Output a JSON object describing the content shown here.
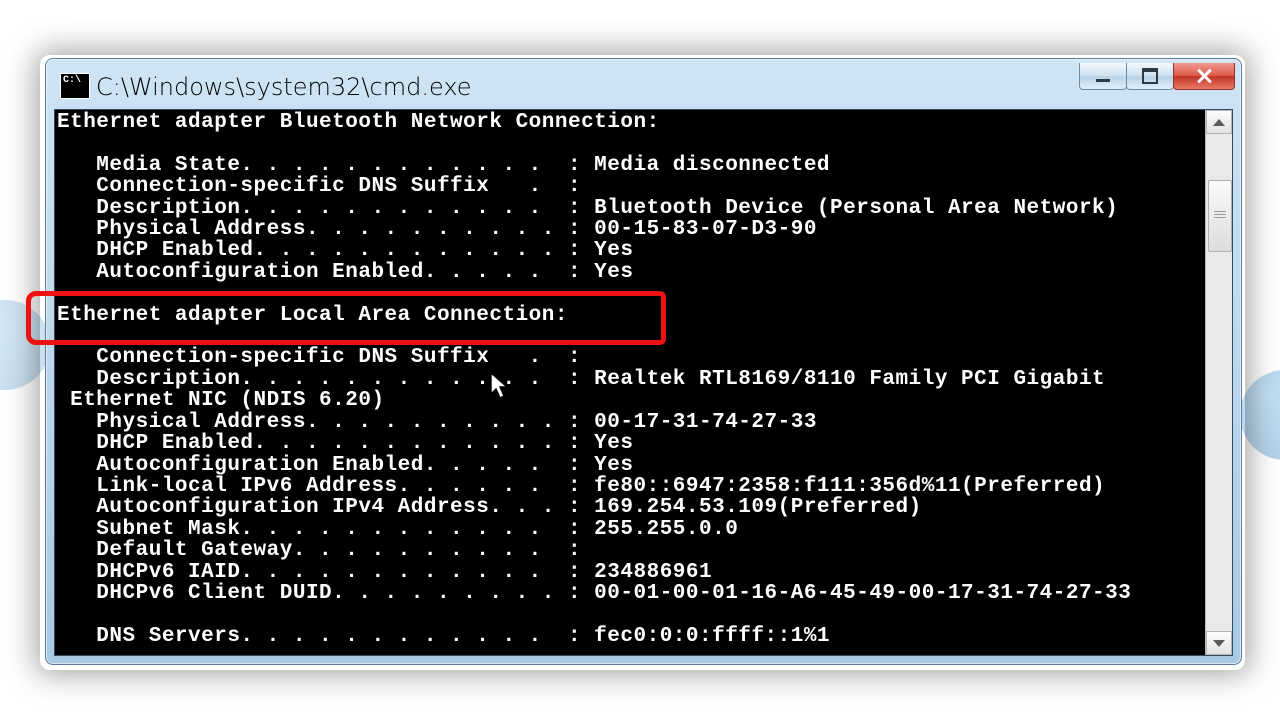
{
  "window": {
    "title": "C:\\Windows\\system32\\cmd.exe"
  },
  "cmd_output": {
    "adapters": [
      {
        "header": "Ethernet adapter Bluetooth Network Connection:",
        "highlighted": false,
        "fields": [
          {
            "label": "Media State",
            "dots": ". . . . . . . . . . .",
            "value": "Media disconnected"
          },
          {
            "label": "Connection-specific DNS Suffix",
            "dots": " .",
            "value": ""
          },
          {
            "label": "Description",
            "dots": ". . . . . . . . . . .",
            "value": "Bluetooth Device (Personal Area Network)"
          },
          {
            "label": "Physical Address",
            "dots": ". . . . . . . . .",
            "value": "00-15-83-07-D3-90"
          },
          {
            "label": "DHCP Enabled",
            "dots": ". . . . . . . . . . .",
            "value": "Yes"
          },
          {
            "label": "Autoconfiguration Enabled",
            "dots": ". . . .",
            "value": "Yes"
          }
        ]
      },
      {
        "header": "Ethernet adapter Local Area Connection:",
        "highlighted": true,
        "fields": [
          {
            "label": "Connection-specific DNS Suffix",
            "dots": " .",
            "value": ""
          },
          {
            "label": "Description",
            "dots": ". . . . . . . . . . .",
            "value": "Realtek RTL8169/8110 Family PCI Gigabit Ethernet NIC (NDIS 6.20)",
            "wrap": true
          },
          {
            "label": "Physical Address",
            "dots": ". . . . . . . . .",
            "value": "00-17-31-74-27-33"
          },
          {
            "label": "DHCP Enabled",
            "dots": ". . . . . . . . . . .",
            "value": "Yes"
          },
          {
            "label": "Autoconfiguration Enabled",
            "dots": ". . . .",
            "value": "Yes"
          },
          {
            "label": "Link-local IPv6 Address",
            "dots": ". . . . .",
            "value": "fe80::6947:2358:f111:356d%11(Preferred)"
          },
          {
            "label": "Autoconfiguration IPv4 Address",
            "dots": ". .",
            "value": "169.254.53.109(Preferred)"
          },
          {
            "label": "Subnet Mask",
            "dots": ". . . . . . . . . . .",
            "value": "255.255.0.0"
          },
          {
            "label": "Default Gateway",
            "dots": ". . . . . . . . .",
            "value": ""
          },
          {
            "label": "DHCPv6 IAID",
            "dots": ". . . . . . . . . . .",
            "value": "234886961"
          },
          {
            "label": "DHCPv6 Client DUID",
            "dots": ". . . . . . . .",
            "value": "00-01-00-01-16-A6-45-49-00-17-31-74-27-33"
          }
        ],
        "trailing": [
          {
            "label": "DNS Servers",
            "dots": ". . . . . . . . . . .",
            "value": "fec0:0:0:ffff::1%1"
          }
        ]
      }
    ]
  }
}
